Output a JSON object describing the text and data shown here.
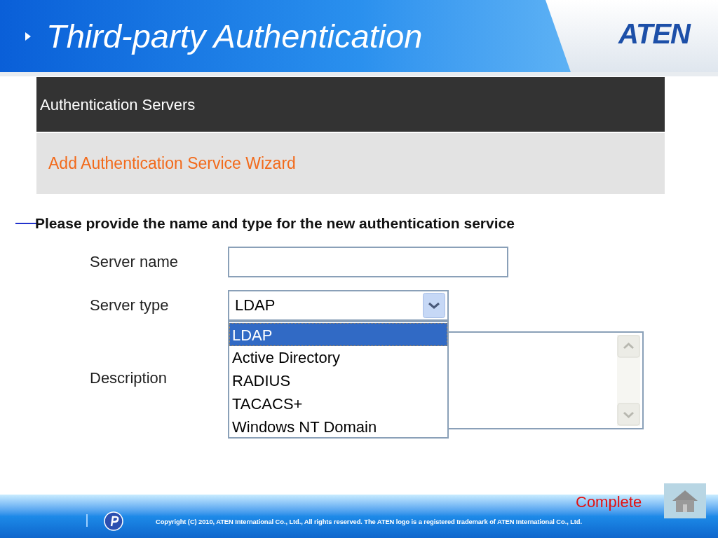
{
  "slide": {
    "title": "Third-party Authentication",
    "logo": "ATEN"
  },
  "panel": {
    "header": "Authentication Servers",
    "wizard_title": "Add Authentication Service Wizard"
  },
  "instruction": "Please provide the name and type for the new authentication service",
  "form": {
    "server_name_label": "Server name",
    "server_type_label": "Server type",
    "server_type_value": "LDAP",
    "description_label": "Description"
  },
  "dropdown_options": [
    {
      "label": "LDAP",
      "selected": true
    },
    {
      "label": "Active Directory",
      "selected": false
    },
    {
      "label": "RADIUS",
      "selected": false
    },
    {
      "label": "TACACS+",
      "selected": false
    },
    {
      "label": "Windows NT Domain",
      "selected": false
    }
  ],
  "footer": {
    "complete": "Complete",
    "copyright": "Copyright (C) 2010, ATEN International Co., Ltd., All rights reserved. The ATEN logo is a registered trademark of ATEN International Co., Ltd."
  }
}
